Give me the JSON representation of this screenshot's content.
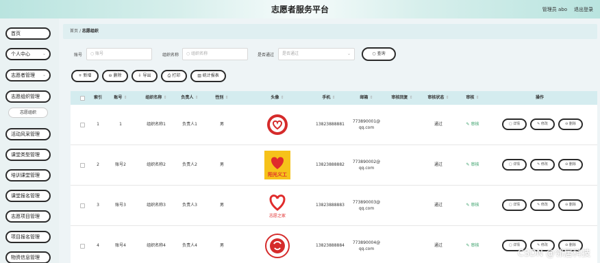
{
  "header": {
    "title": "志愿者服务平台",
    "admin": "管理员 abo",
    "logout": "退出登录"
  },
  "sidebar": {
    "items": [
      {
        "label": "首页",
        "chev": ""
      },
      {
        "label": "个人中心",
        "chev": "⌄"
      },
      {
        "label": "志愿者管理",
        "chev": "⌄"
      },
      {
        "label": "志愿组织管理",
        "chev": ""
      },
      {
        "label": "活动风采管理",
        "chev": ""
      },
      {
        "label": "课堂类型管理",
        "chev": ""
      },
      {
        "label": "培训课堂管理",
        "chev": ""
      },
      {
        "label": "课堂报名管理",
        "chev": ""
      },
      {
        "label": "志愿项目管理",
        "chev": ""
      },
      {
        "label": "项目报名管理",
        "chev": ""
      },
      {
        "label": "物资信息管理",
        "chev": ""
      }
    ],
    "sub_item": "志愿组织"
  },
  "breadcrumb": {
    "home": "首页",
    "sep": "/",
    "current": "志愿组织"
  },
  "search": {
    "account_label": "账号",
    "account_placeholder": "○ 账号",
    "org_label": "组织名称",
    "org_placeholder": "○ 组织名称",
    "passed_label": "是否通过",
    "passed_placeholder": "是否通过",
    "query_label": "○ 查询"
  },
  "toolbar": {
    "add": "+ 新增",
    "delete": "⊖ 删除",
    "export": "⇩ 导出",
    "print": "⎙ 打印",
    "stats": "▥ 统计报表"
  },
  "table": {
    "headers": {
      "index": "索引",
      "account": "账号",
      "org_name": "组织名称",
      "leader": "负责人",
      "gender": "性别",
      "avatar": "头像",
      "phone": "手机",
      "email": "邮箱",
      "audit_reply": "审核回复",
      "audit_status": "审核状态",
      "audit": "审核",
      "actions": "操作",
      "sort": "⇕"
    },
    "rows": [
      {
        "index": "1",
        "account": "1",
        "org_name": "组织名称1",
        "leader": "负责人1",
        "gender": "男",
        "phone": "13823888881",
        "email_a": "773890001@",
        "email_b": "qq.com",
        "audit_reply": "",
        "audit_status": "通过",
        "audit": "✎ 审核"
      },
      {
        "index": "2",
        "account": "账号2",
        "org_name": "组织名称2",
        "leader": "负责人2",
        "gender": "男",
        "phone": "13823888882",
        "email_a": "773890002@",
        "email_b": "qq.com",
        "audit_reply": "",
        "audit_status": "通过",
        "audit": "✎ 审核",
        "avatar_text": "阳光义工"
      },
      {
        "index": "3",
        "account": "账号3",
        "org_name": "组织名称3",
        "leader": "负责人3",
        "gender": "男",
        "phone": "13823888883",
        "email_a": "773890003@",
        "email_b": "qq.com",
        "audit_reply": "",
        "audit_status": "通过",
        "audit": "✎ 审核",
        "avatar_text": "志愿之家"
      },
      {
        "index": "4",
        "account": "账号4",
        "org_name": "组织名称4",
        "leader": "负责人4",
        "gender": "男",
        "phone": "13823888884",
        "email_a": "773890004@",
        "email_b": "qq.com",
        "audit_reply": "",
        "audit_status": "通过",
        "audit": "✎ 审核"
      }
    ],
    "ops": {
      "detail": "▢ 详情",
      "edit": "✎ 修改",
      "delete": "⊖ 删除"
    }
  },
  "watermark": "CSDN @邻居科技",
  "colors": {
    "accent_red": "#e02b2b",
    "yellow": "#f6c21a",
    "link_green": "#3aa06a",
    "header_teal": "#b9e4df"
  }
}
